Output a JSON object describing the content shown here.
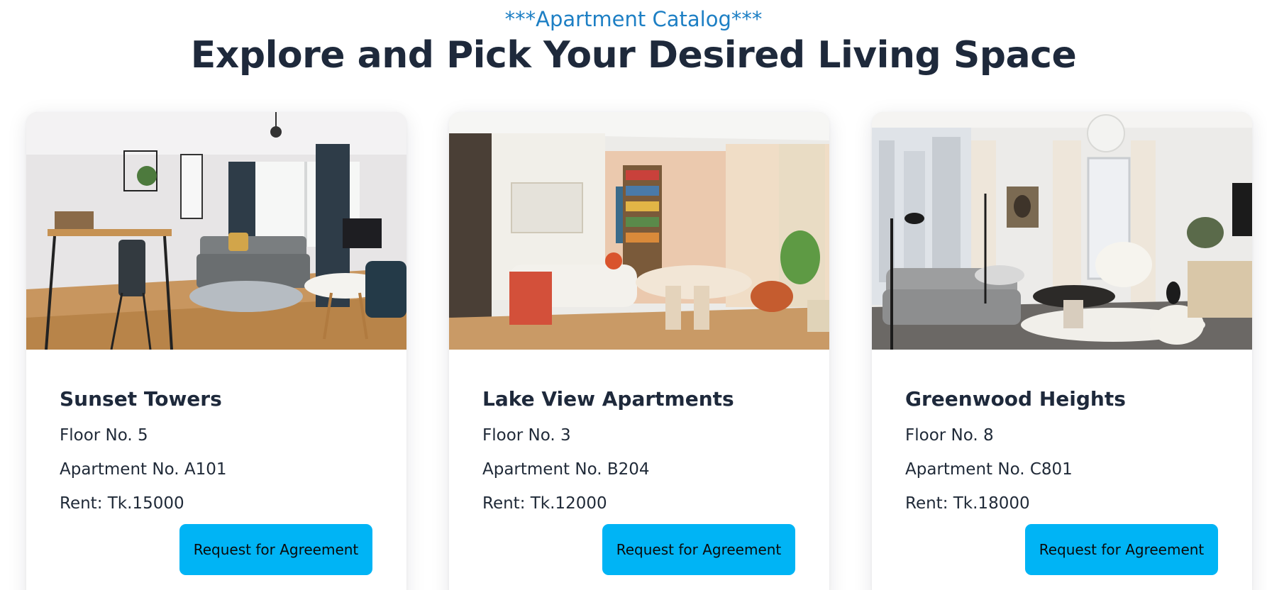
{
  "header": {
    "kicker": "***Apartment Catalog***",
    "title": "Explore and Pick Your Desired Living Space"
  },
  "apartments": [
    {
      "name": "Sunset Towers",
      "floor": "Floor No. 5",
      "apartment": "Apartment No. A101",
      "rent": "Rent: Tk.15000",
      "button": "Request for Agreement",
      "image": "living-room-photo-sunset-towers"
    },
    {
      "name": "Lake View Apartments",
      "floor": "Floor No. 3",
      "apartment": "Apartment No. B204",
      "rent": "Rent: Tk.12000",
      "button": "Request for Agreement",
      "image": "living-room-photo-lake-view"
    },
    {
      "name": "Greenwood Heights",
      "floor": "Floor No. 8",
      "apartment": "Apartment No. C801",
      "rent": "Rent: Tk.18000",
      "button": "Request for Agreement",
      "image": "living-room-photo-greenwood"
    }
  ],
  "colors": {
    "kicker": "#1d7fc4",
    "title": "#1e293b",
    "button": "#00b4f5",
    "card_bg": "#ffffff"
  }
}
